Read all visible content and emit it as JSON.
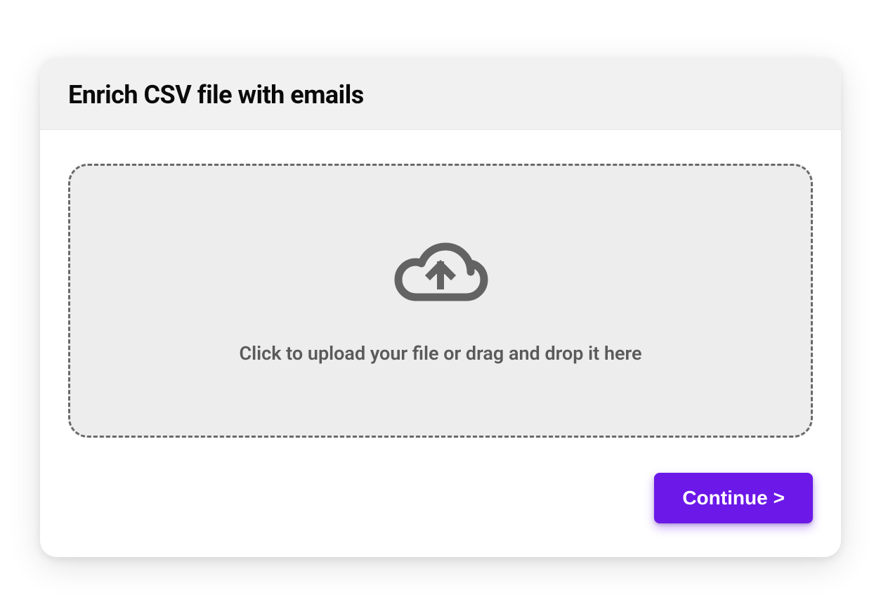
{
  "header": {
    "title": "Enrich CSV file with emails"
  },
  "dropzone": {
    "instruction": "Click to upload your file or drag and drop it here",
    "icon": "cloud-upload-icon"
  },
  "actions": {
    "continue_label": "Continue",
    "continue_chevron": ">"
  },
  "colors": {
    "accent": "#6b18e8",
    "dropzone_bg": "#eeedee",
    "header_bg": "#f2f1f2",
    "text_muted": "#5a5a5a",
    "border_dashed": "#6a6a6a"
  }
}
